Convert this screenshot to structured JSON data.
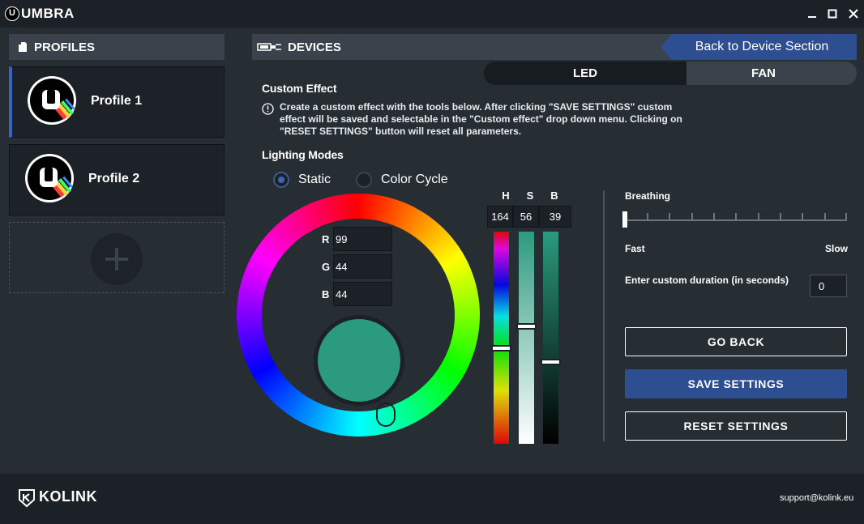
{
  "app": {
    "title": "UMBRA",
    "logo_letter": "U"
  },
  "window_controls": {
    "minimize_icon": "minimize-icon",
    "maximize_icon": "maximize-icon",
    "close_icon": "close-icon"
  },
  "sidebar": {
    "header": "PROFILES",
    "profiles": [
      {
        "name": "Profile 1",
        "avatar_letter": "U",
        "active": true
      },
      {
        "name": "Profile 2",
        "avatar_letter": "U",
        "active": false
      }
    ],
    "add_icon": "plus-icon"
  },
  "devices": {
    "header": "DEVICES",
    "back_button": "Back to Device Section",
    "tabs": [
      {
        "label": "LED"
      },
      {
        "label": "FAN"
      }
    ]
  },
  "custom_effect": {
    "title": "Custom Effect",
    "info": "Create a custom effect with the tools below. After clicking \"SAVE SETTINGS\" custom effect will be saved and selectable in the \"Custom effect\" drop down menu. Clicking on \"RESET SETTINGS\" button will reset all parameters."
  },
  "lighting_modes": {
    "title": "Lighting Modes",
    "options": [
      {
        "label": "Static",
        "selected": true
      },
      {
        "label": "Color Cycle",
        "selected": false
      }
    ]
  },
  "color": {
    "rgb": {
      "r_label": "R",
      "g_label": "G",
      "b_label": "B",
      "r": "99",
      "g": "44",
      "b": "44"
    },
    "hsb": {
      "h_label": "H",
      "s_label": "S",
      "b_label": "B",
      "h": "164",
      "s": "56",
      "b": "39"
    },
    "swatch_color": "#2c9a7d"
  },
  "breathing": {
    "title": "Breathing",
    "fast_label": "Fast",
    "slow_label": "Slow",
    "level": 0,
    "duration_label": "Enter custom duration (in seconds)",
    "duration_value": "0"
  },
  "actions": {
    "go_back": "GO BACK",
    "save": "SAVE SETTINGS",
    "reset": "RESET SETTINGS"
  },
  "footer": {
    "brand": "KOLINK",
    "support": "support@kolink.eu"
  },
  "colors": {
    "accent": "#2e4e92",
    "background": "#262d33",
    "titlebar": "#1b2126"
  }
}
